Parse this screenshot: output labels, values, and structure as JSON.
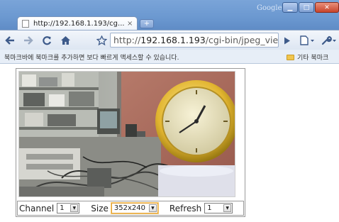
{
  "browser": {
    "brand_label": "Google",
    "tab": {
      "title": "http://192.168.1.193/cg...",
      "close_glyph": "×"
    },
    "new_tab_glyph": "+",
    "window_controls": {
      "minimize": "▁",
      "maximize": "□",
      "close": "✕"
    },
    "url": {
      "scheme": "http://",
      "host": "192.168.1.193",
      "path": "/cgi-bin/jpeg_view"
    },
    "bookmarks_hint": "북마크바에 북마크를 추가하면 보다 빠르게 액세스할 수 있습니다.",
    "other_bookmarks": "기타 북마크"
  },
  "viewer": {
    "channel": {
      "label": "Channel",
      "value": "1"
    },
    "size": {
      "label": "Size",
      "value": "352x240"
    },
    "refresh": {
      "label": "Refresh",
      "value": "1"
    }
  },
  "colors": {
    "titlebar": "#6b98d0",
    "accent_focus": "#e2a23a"
  }
}
